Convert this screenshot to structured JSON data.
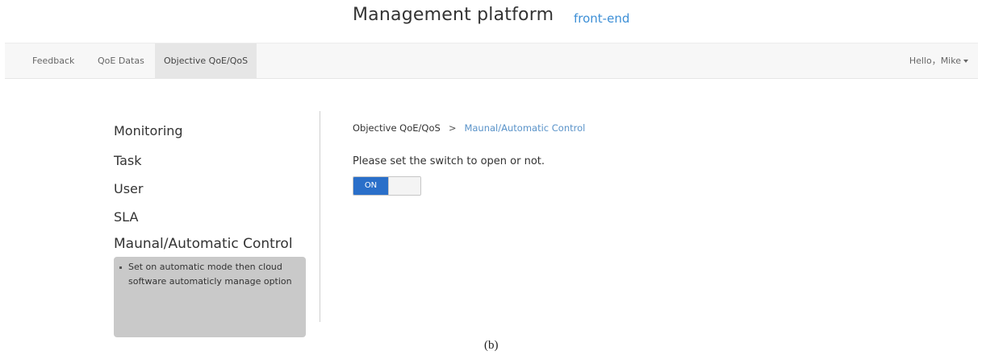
{
  "header": {
    "title": "Management platform",
    "subtitle": "front-end"
  },
  "navbar": {
    "items": [
      {
        "label": "Feedback",
        "active": false
      },
      {
        "label": "QoE Datas",
        "active": false
      },
      {
        "label": "Objective QoE/QoS",
        "active": true
      }
    ],
    "user_greeting": "Hello，Mike"
  },
  "sidebar": {
    "items": [
      {
        "label": "Monitoring"
      },
      {
        "label": "Task"
      },
      {
        "label": "User"
      },
      {
        "label": "SLA"
      },
      {
        "label": "Maunal/Automatic Control"
      }
    ],
    "tooltip": "Set on automatic mode then cloud software automaticly manage option"
  },
  "main": {
    "breadcrumb": {
      "root": "Objective QoE/QoS",
      "separator": ">",
      "current": "Maunal/Automatic Control"
    },
    "prompt": "Please set the switch to open or not.",
    "switch": {
      "label": "ON",
      "state": "on",
      "on_color": "#2a6fc9"
    }
  },
  "caption": "(b)"
}
